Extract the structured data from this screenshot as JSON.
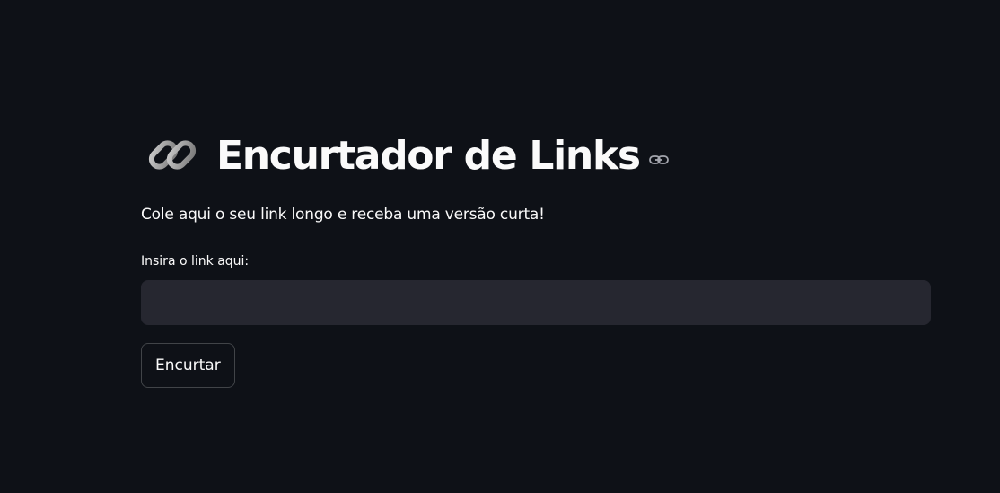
{
  "header": {
    "emoji_icon": "link-chain-emoji",
    "title": "Encurtador de Links",
    "anchor_icon": "link-icon"
  },
  "main": {
    "description": "Cole aqui o seu link longo e receba uma versão curta!",
    "url_input": {
      "label": "Insira o link aqui:",
      "value": "",
      "placeholder": ""
    },
    "submit_button": {
      "label": "Encurtar"
    }
  },
  "colors": {
    "background": "#0e1117",
    "input_background": "#262730",
    "text": "#fafafa",
    "button_border": "#4a4c55"
  }
}
